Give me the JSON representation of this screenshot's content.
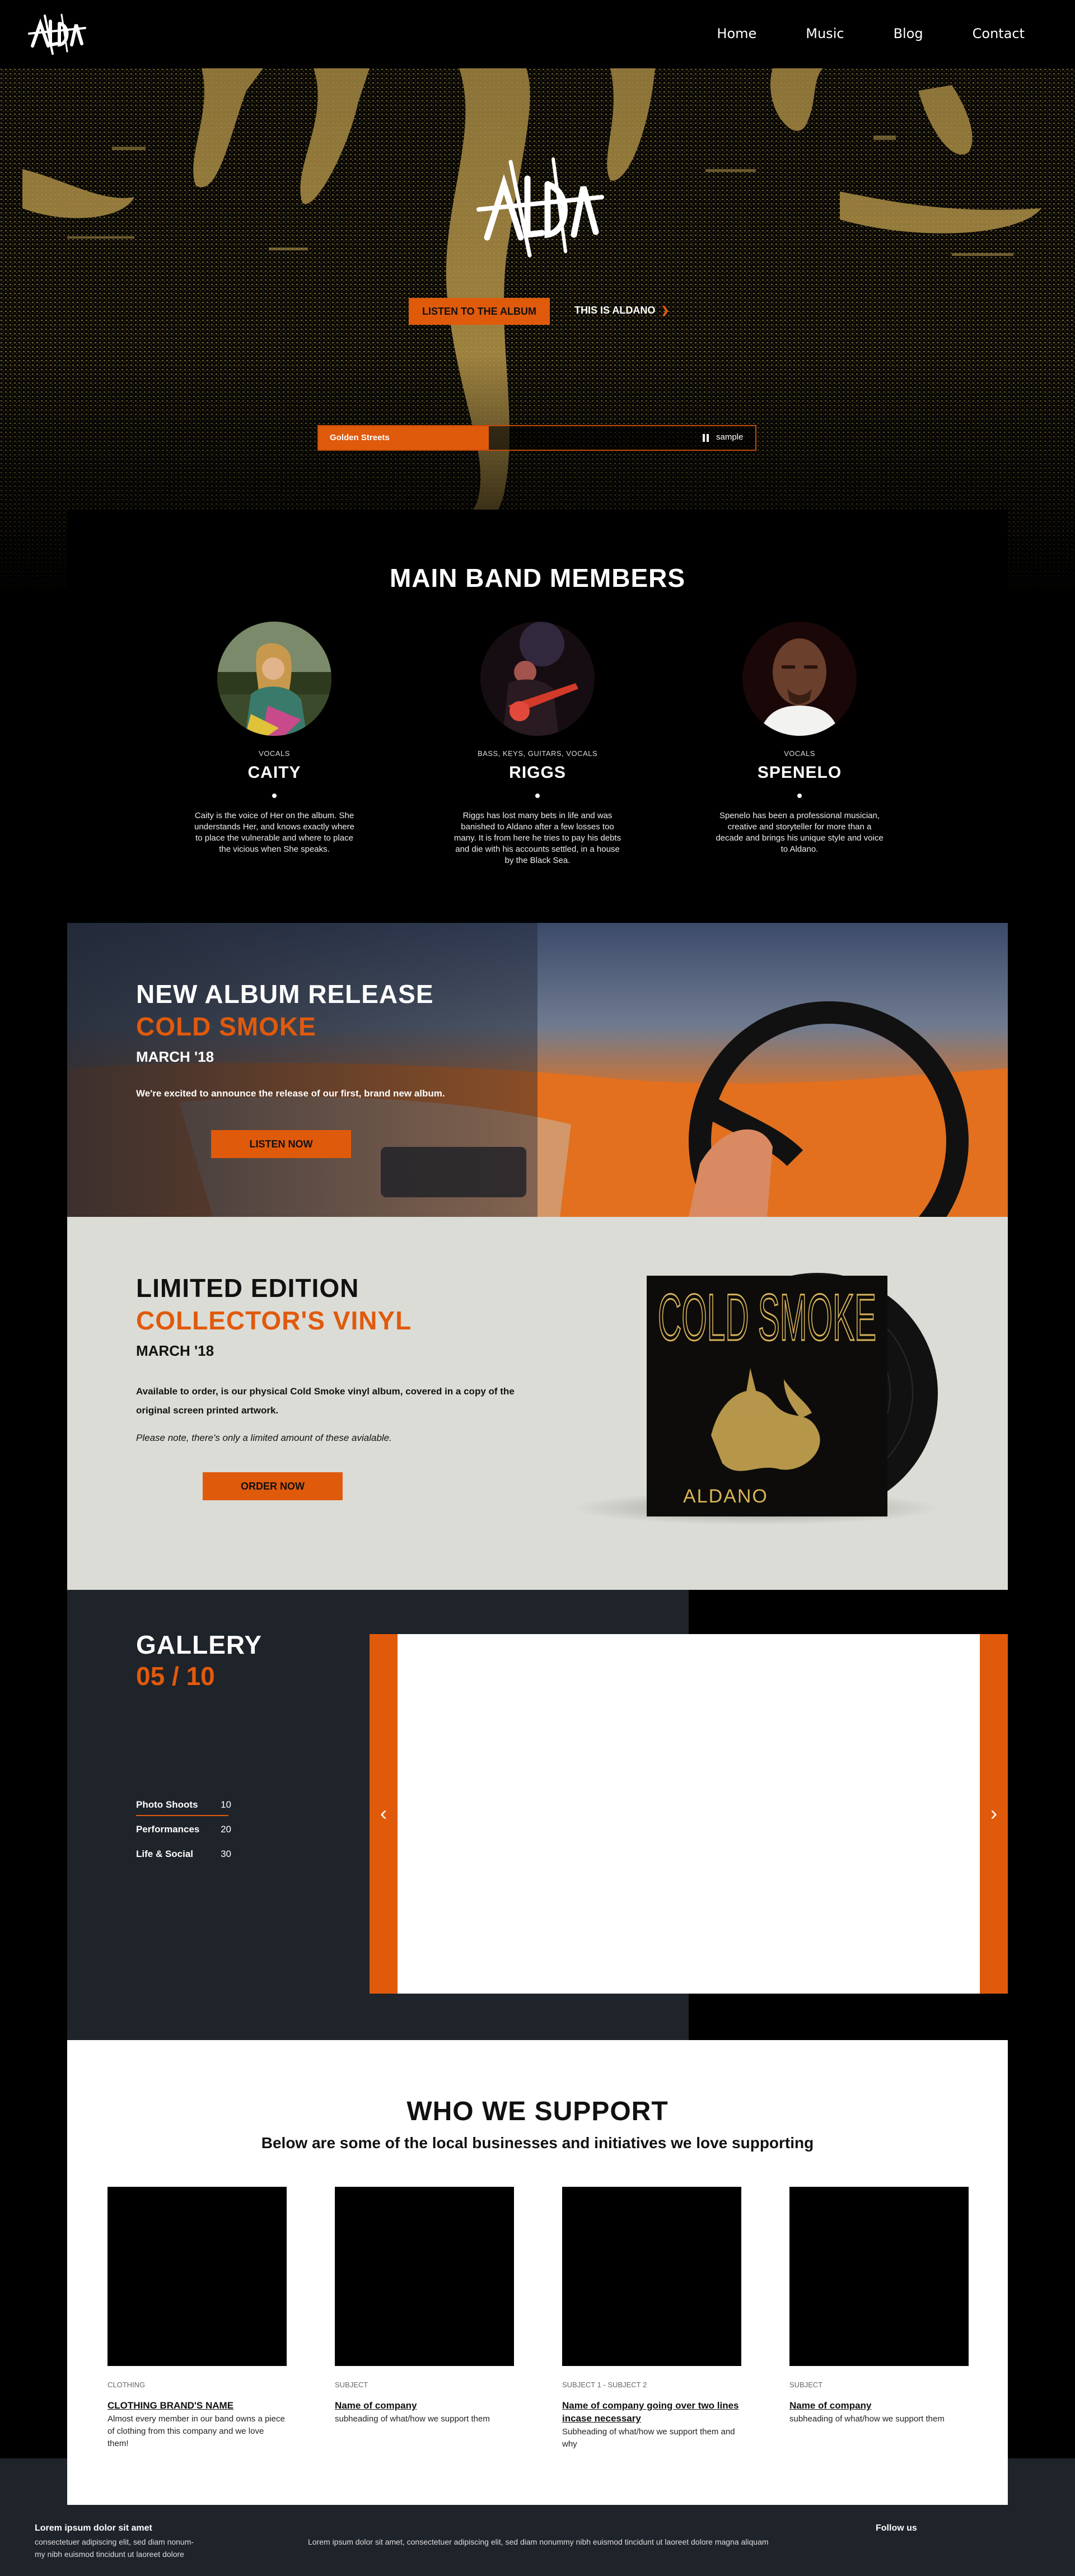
{
  "nav": {
    "logo_text": "ALDANO",
    "links": [
      "Home",
      "Music",
      "Blog",
      "Contact"
    ]
  },
  "hero": {
    "logo_text": "ALDANO",
    "listen_button": "LISTEN TO THE ALBUM",
    "this_is_link": "THIS IS ALDANO",
    "player": {
      "track": "Golden Streets",
      "progress": 0.39,
      "sample_label": "sample"
    }
  },
  "members": {
    "title": "MAIN BAND MEMBERS",
    "list": [
      {
        "role": "VOCALS",
        "name": "CAITY",
        "bio": "Caity is the voice of Her on the album. She understands Her, and knows exactly where to place the vulnerable and where to place the vicious when She speaks."
      },
      {
        "role": "BASS, KEYS, GUITARS, VOCALS",
        "name": "RIGGS",
        "bio": "Riggs has lost many bets in life and was banished to Aldano after a few losses too many. It is from here he tries to pay his debts and die with his accounts settled, in a house by the Black Sea."
      },
      {
        "role": "VOCALS",
        "name": "SPENELO",
        "bio": "Spenelo has been a professional musician, creative and storyteller for more than a decade and brings his unique style and voice to Aldano."
      }
    ]
  },
  "new_album": {
    "heading": "NEW ALBUM RELEASE",
    "album_name": "COLD SMOKE",
    "date": "MARCH '18",
    "description": "We're excited to announce the release of our first, brand new album.",
    "button": "LISTEN NOW"
  },
  "vinyl": {
    "heading": "LIMITED EDITION",
    "subheading": "COLLECTOR'S VINYL",
    "date": "MARCH '18",
    "description": "Available to order, is our physical Cold Smoke vinyl album, covered in a copy of the original screen printed artwork.",
    "note": "Please note, there's only a limited amount of these avialable.",
    "button": "ORDER NOW",
    "cover_title": "COLD SMOKE",
    "cover_band": "ALDANO"
  },
  "gallery": {
    "title": "GALLERY",
    "counter": "05 / 10",
    "categories": [
      {
        "label": "Photo Shoots",
        "count": "10"
      },
      {
        "label": "Performances",
        "count": "20"
      },
      {
        "label": "Life & Social",
        "count": "30"
      }
    ]
  },
  "support": {
    "title": "WHO WE SUPPORT",
    "subtitle": "Below are some of the local businesses and initiatives we love supporting",
    "cards": [
      {
        "subject": "CLOTHING",
        "name": "CLOTHING BRAND'S NAME",
        "desc": "Almost every member in our band owns a piece of clothing from this company and we love them!"
      },
      {
        "subject": "SUBJECT",
        "name": "Name of company",
        "desc": "subheading of what/how we support them"
      },
      {
        "subject": "SUBJECT 1 - SUBJECT 2",
        "name": "Name of company going over two lines incase necessary",
        "desc": "Subheading of what/how we support them and why"
      },
      {
        "subject": "SUBJECT",
        "name": "Name of company",
        "desc": "subheading of what/how we support them"
      }
    ]
  },
  "footer": {
    "left_title": "Lorem ipsum dolor sit amet",
    "left_text": "consectetuer adipiscing elit, sed diam nonum-my nibh euismod tincidunt ut laoreet dolore",
    "center_text": "Lorem ipsum dolor sit amet, consectetuer adipiscing elit, sed diam nonummy nibh euismod tincidunt ut laoreet dolore magna aliquam",
    "right_title": "Follow us"
  },
  "colors": {
    "accent": "#e05a0c",
    "dark_panel": "#1f232a",
    "vinyl_bg": "#dcdcd6",
    "gold": "#d9b45a"
  }
}
